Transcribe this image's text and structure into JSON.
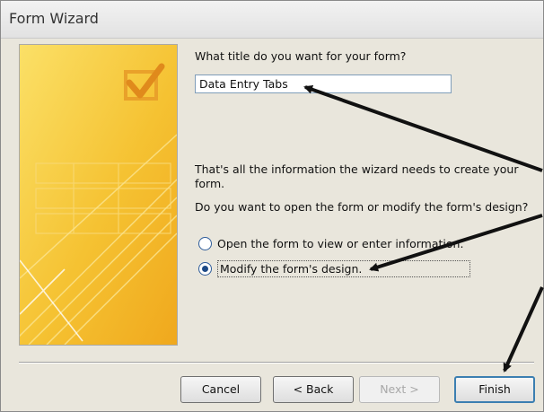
{
  "window": {
    "title": "Form Wizard"
  },
  "form": {
    "title_question": "What title do you want for your form?",
    "title_value": "Data Entry Tabs",
    "info_text": "That's all the information the wizard needs to create your form.",
    "open_question": "Do you want to open the form or modify the form's design?",
    "options": [
      {
        "label": "Open the form to view or enter information.",
        "selected": false
      },
      {
        "label": "Modify the form's design.",
        "selected": true
      }
    ]
  },
  "buttons": {
    "cancel": "Cancel",
    "back": "< Back",
    "next": "Next >",
    "finish": "Finish"
  },
  "colors": {
    "art_yellow": "#f7c93a",
    "art_orange": "#efa51c",
    "arrow": "#111111"
  }
}
